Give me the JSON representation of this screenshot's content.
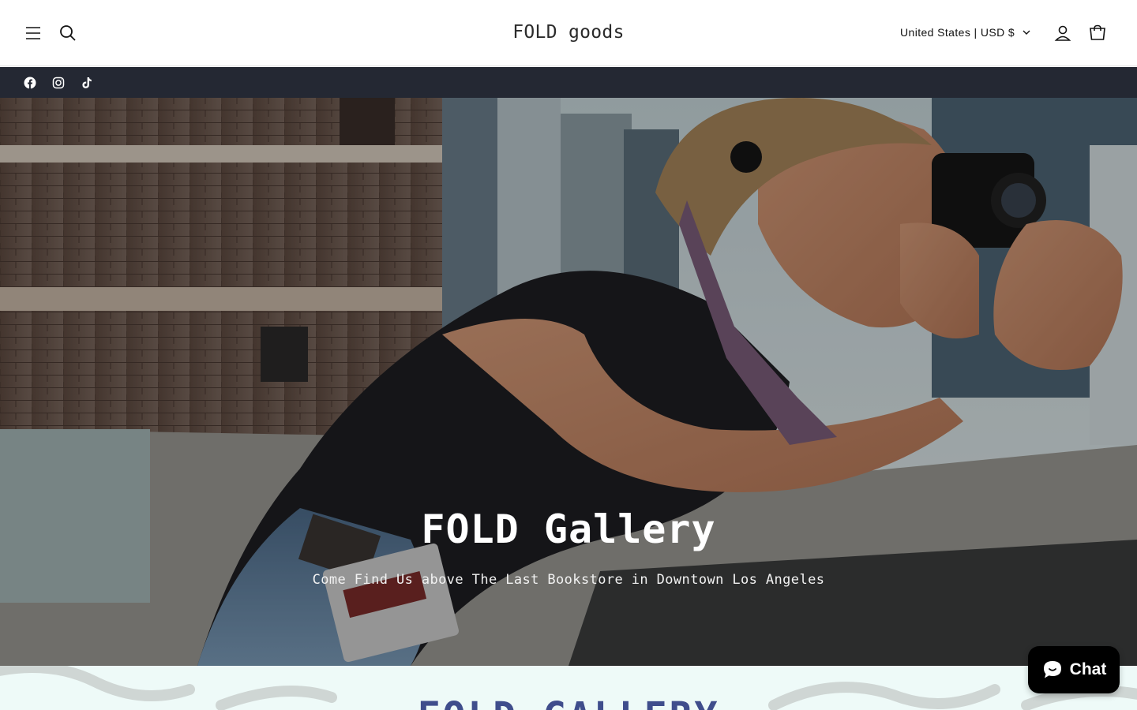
{
  "header": {
    "logo": "FOLD goods",
    "country_selector": "United States | USD $",
    "icons": {
      "menu": "hamburger-menu-icon",
      "search": "search-icon",
      "account": "account-icon",
      "cart": "cart-icon",
      "dropdown": "chevron-down-icon"
    }
  },
  "social_bar": {
    "links": [
      {
        "icon": "facebook-icon"
      },
      {
        "icon": "instagram-icon"
      },
      {
        "icon": "tiktok-icon"
      }
    ],
    "background": "#242833"
  },
  "hero": {
    "title": "FOLD Gallery",
    "subtitle": "Come Find Us above The Last Bookstore in Downtown Los Angeles"
  },
  "next_section": {
    "title": "FOLD GALLERY",
    "background": "#eefaf8",
    "title_color": "#3f4d8c"
  },
  "chat": {
    "label": "Chat",
    "icon": "chat-bubble-icon"
  }
}
